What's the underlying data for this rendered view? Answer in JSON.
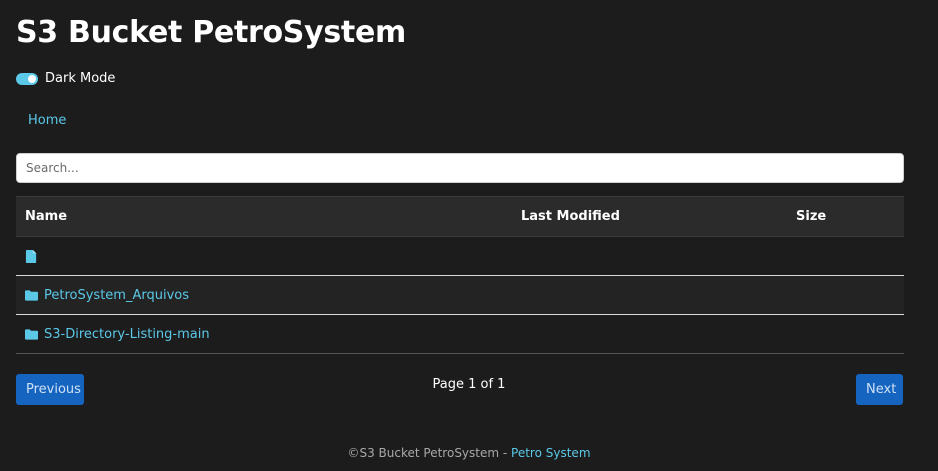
{
  "header": {
    "title": "S3 Bucket PetroSystem"
  },
  "dark_mode": {
    "label": "Dark Mode",
    "enabled": true
  },
  "breadcrumb": {
    "home": "Home"
  },
  "search": {
    "placeholder": "Search...",
    "value": ""
  },
  "table": {
    "columns": [
      "Name",
      "Last Modified",
      "Size"
    ],
    "rows": [
      {
        "icon": "file-icon",
        "name": "",
        "last_modified": "",
        "size": ""
      },
      {
        "icon": "folder-icon",
        "name": "PetroSystem_Arquivos",
        "last_modified": "",
        "size": ""
      },
      {
        "icon": "folder-icon",
        "name": "S3-Directory-Listing-main",
        "last_modified": "",
        "size": ""
      }
    ]
  },
  "pagination": {
    "previous": "Previous",
    "next": "Next",
    "info": "Page 1 of 1"
  },
  "footer": {
    "text": "©S3 Bucket PetroSystem - ",
    "link": "Petro System"
  },
  "colors": {
    "background": "#1c1c1c",
    "accent": "#5bc8e8",
    "button": "#1565c0"
  }
}
